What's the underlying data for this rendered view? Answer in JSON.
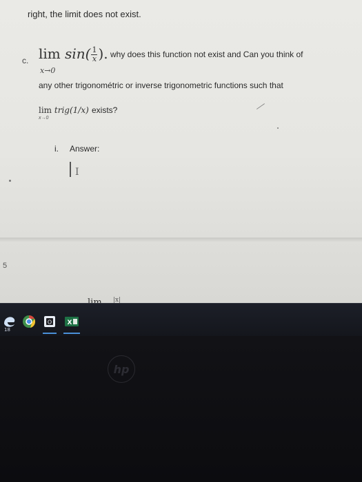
{
  "document": {
    "intro_line": "right, the limit does not exist.",
    "part_label": "c.",
    "limit_expr": {
      "lim": "lim",
      "func": "sin(",
      "frac_num": "1",
      "frac_den": "x",
      "close": ").",
      "subscript": "x→0"
    },
    "question_line1": "why does this function not exist and Can you think of",
    "question_line2": "any other trigonométric or inverse trigonometric functions such that",
    "limit2": {
      "lim": "lim",
      "expr": "trig(1/x)",
      "subscript": "x→0"
    },
    "question_line3": "exists?",
    "answer_roman": "i.",
    "answer_label": "Answer:",
    "ibeam": "I",
    "page_number": "5",
    "next_limit": {
      "lim": "lim",
      "frac": "|x|"
    }
  },
  "taskbar": {
    "badge": "18",
    "icons": [
      "edge-icon",
      "chrome-icon",
      "outlook-icon",
      "excel-icon"
    ]
  },
  "bezel": {
    "logo": "hp"
  }
}
